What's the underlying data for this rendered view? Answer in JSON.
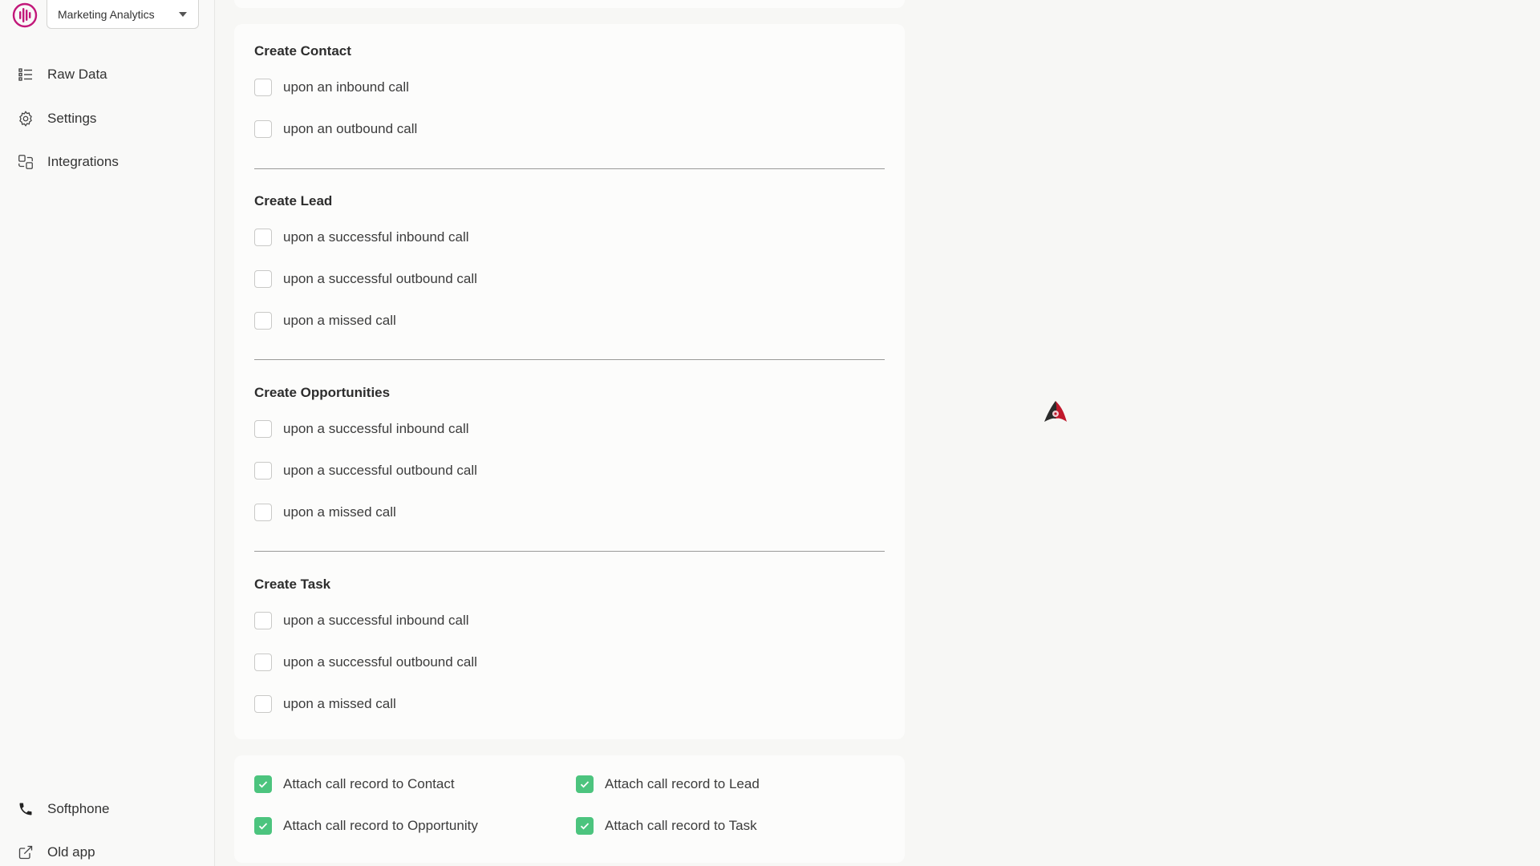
{
  "account": {
    "selected": "Marketing Analytics"
  },
  "sidebar": {
    "items": [
      {
        "label": "Raw Data",
        "icon": "grid-list-icon"
      },
      {
        "label": "Settings",
        "icon": "gear-icon"
      },
      {
        "label": "Integrations",
        "icon": "integrations-icon"
      }
    ],
    "bottom_items": [
      {
        "label": "Softphone",
        "icon": "phone-icon"
      },
      {
        "label": "Old app",
        "icon": "external-link-icon"
      }
    ]
  },
  "sections": [
    {
      "title": "Create Contact",
      "options": [
        {
          "label": "upon an inbound call",
          "checked": false
        },
        {
          "label": "upon an outbound call",
          "checked": false
        }
      ]
    },
    {
      "title": "Create Lead",
      "options": [
        {
          "label": "upon a successful inbound call",
          "checked": false
        },
        {
          "label": "upon a successful outbound call",
          "checked": false
        },
        {
          "label": "upon a missed call",
          "checked": false
        }
      ]
    },
    {
      "title": "Create Opportunities",
      "options": [
        {
          "label": "upon a successful inbound call",
          "checked": false
        },
        {
          "label": "upon a successful outbound call",
          "checked": false
        },
        {
          "label": "upon a missed call",
          "checked": false
        }
      ]
    },
    {
      "title": "Create Task",
      "options": [
        {
          "label": "upon a successful inbound call",
          "checked": false
        },
        {
          "label": "upon a successful outbound call",
          "checked": false
        },
        {
          "label": "upon a missed call",
          "checked": false
        }
      ]
    }
  ],
  "attach": [
    {
      "label": "Attach call record to Contact",
      "checked": true
    },
    {
      "label": "Attach call record to Lead",
      "checked": true
    },
    {
      "label": "Attach call record to Opportunity",
      "checked": true
    },
    {
      "label": "Attach call record to Task",
      "checked": true
    }
  ],
  "colors": {
    "brand": "#c2187a",
    "check": "#4cc47e"
  }
}
